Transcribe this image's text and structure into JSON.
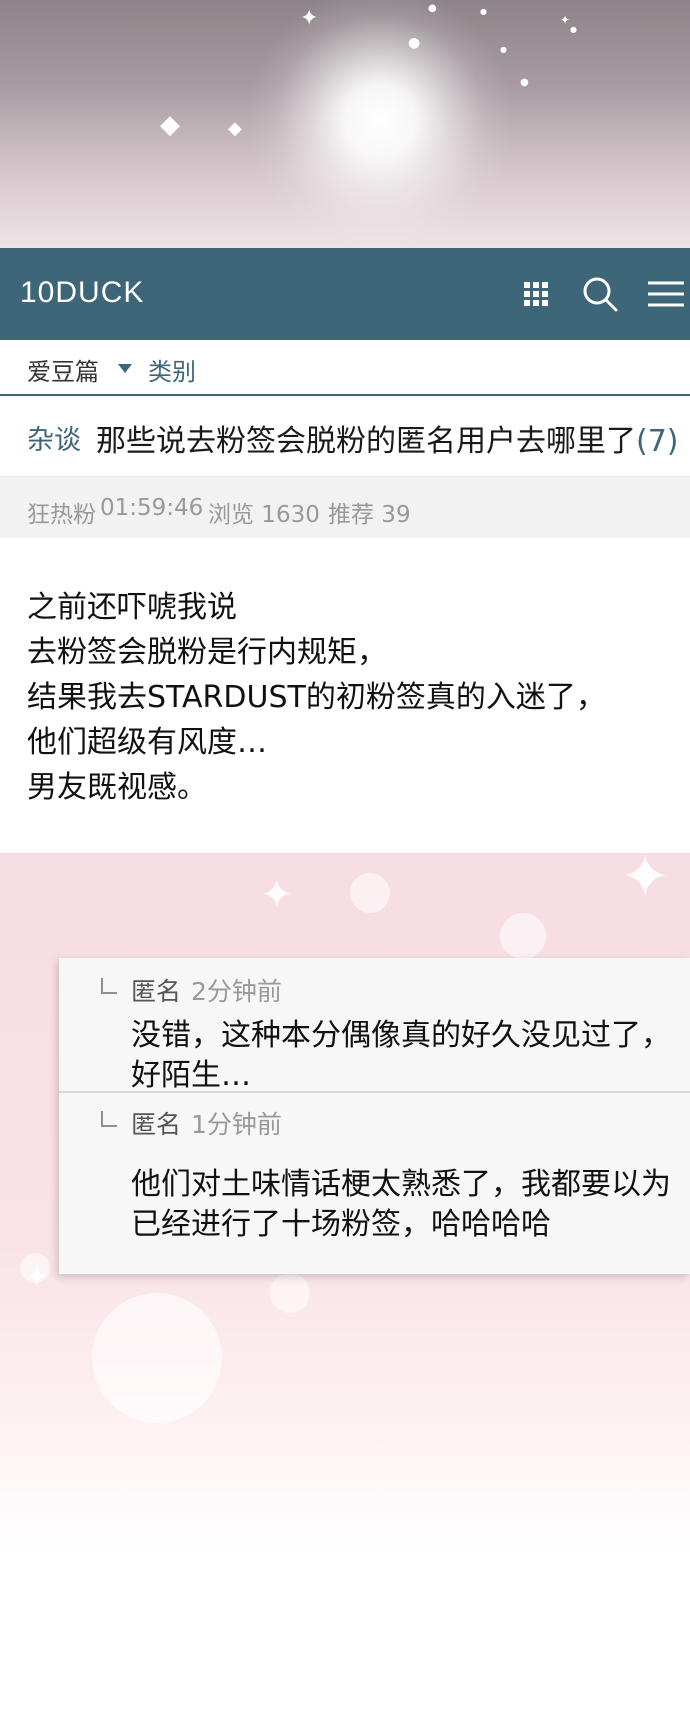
{
  "header": {
    "logo": "10DUCK",
    "icons": [
      "grid-icon",
      "search-icon",
      "menu-icon"
    ]
  },
  "category_bar": {
    "board": "爱豆篇",
    "category": "类别"
  },
  "post": {
    "tag": "杂谈",
    "title": "那些说去粉签会脱粉的匿名用户去哪里了",
    "comment_count": "(7)",
    "author": "狂热粉",
    "time": "01:59:46",
    "views": "浏览 1630",
    "recommends": "推荐 39",
    "body": [
      "之前还吓唬我说",
      "去粉签会脱粉是行内规矩，",
      "结果我去STARDUST的初粉签真的入迷了，",
      "他们超级有风度…",
      "男友既视感。"
    ]
  },
  "comments": [
    {
      "author": "匿名",
      "time": "2分钟前",
      "lines": [
        "没错，这种本分偶像真的好久没见过了，",
        "好陌生…"
      ]
    },
    {
      "author": "匿名",
      "time": "1分钟前",
      "lines": [
        "他们对土味情话梗太熟悉了，我都要以为",
        "已经进行了十场粉签，哈哈哈哈"
      ]
    }
  ],
  "colors": {
    "header_bg": "#3e6679",
    "accent": "#3e6679",
    "meta_text": "#999999"
  }
}
